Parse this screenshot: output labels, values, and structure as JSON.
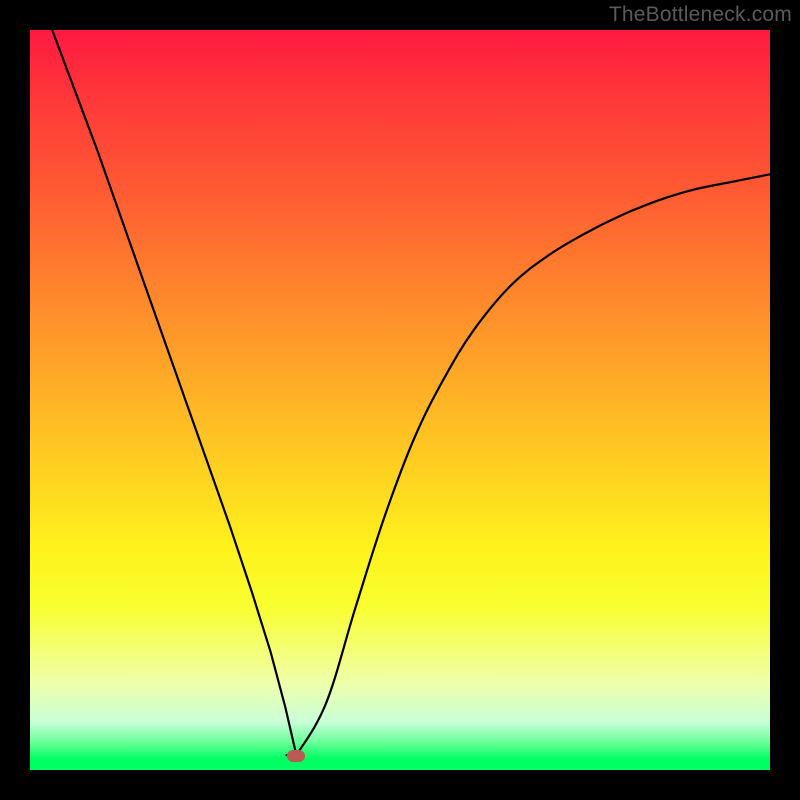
{
  "watermark": "TheBottleneck.com",
  "marker": {
    "x_pct": 36.0,
    "y_pct": 98.1
  },
  "chart_data": {
    "type": "line",
    "title": "",
    "xlabel": "",
    "ylabel": "",
    "xlim": [
      0,
      1
    ],
    "ylim": [
      0,
      1
    ],
    "series": [
      {
        "name": "curve",
        "x": [
          0.03,
          0.06,
          0.09,
          0.12,
          0.15,
          0.18,
          0.21,
          0.24,
          0.27,
          0.3,
          0.325,
          0.345,
          0.36,
          0.4,
          0.44,
          0.48,
          0.52,
          0.56,
          0.6,
          0.65,
          0.7,
          0.75,
          0.8,
          0.85,
          0.9,
          0.95,
          1.0
        ],
        "y": [
          1.0,
          0.92,
          0.84,
          0.755,
          0.67,
          0.585,
          0.5,
          0.415,
          0.33,
          0.24,
          0.16,
          0.085,
          0.02,
          0.09,
          0.22,
          0.345,
          0.45,
          0.53,
          0.595,
          0.655,
          0.695,
          0.725,
          0.75,
          0.77,
          0.785,
          0.795,
          0.805
        ]
      }
    ],
    "gradient_stops": [
      {
        "pos": 0.0,
        "color": "#ff1a40"
      },
      {
        "pos": 0.5,
        "color": "#ffc822"
      },
      {
        "pos": 0.75,
        "color": "#fff21c"
      },
      {
        "pos": 0.97,
        "color": "#6bff9a"
      },
      {
        "pos": 1.0,
        "color": "#00ff62"
      }
    ],
    "marker": {
      "x": 0.36,
      "y": 0.019,
      "color": "#b95a55"
    }
  }
}
